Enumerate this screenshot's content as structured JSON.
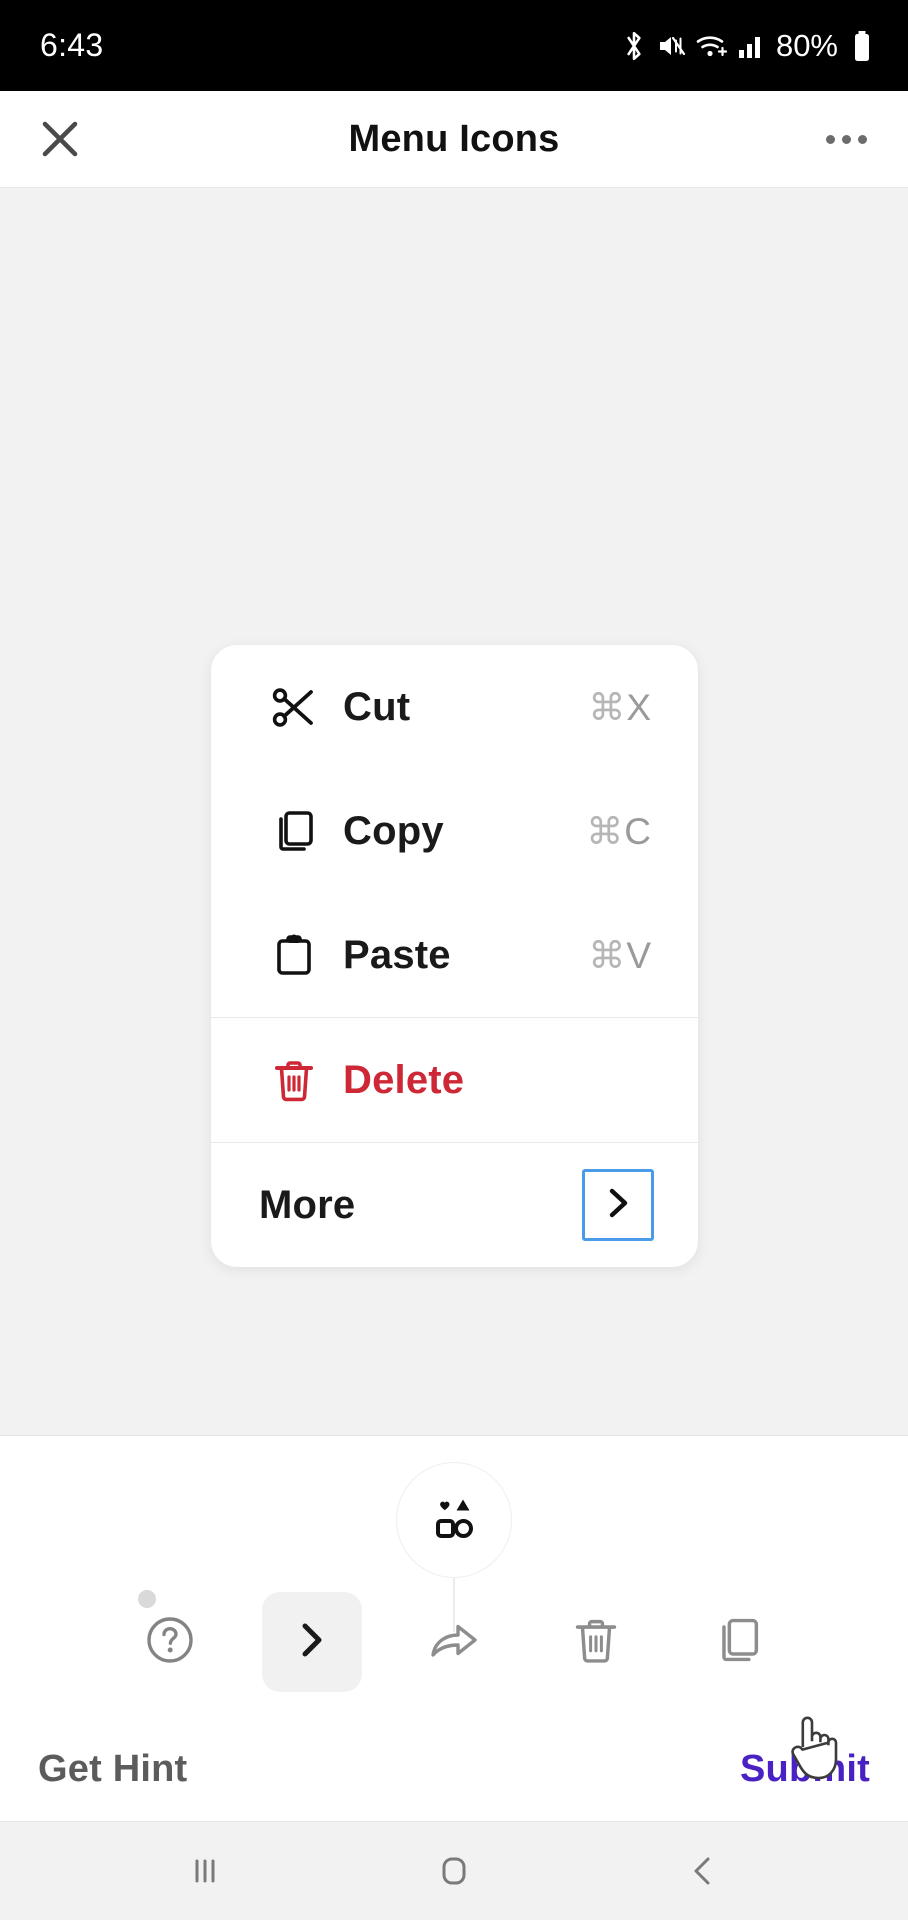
{
  "status_bar": {
    "time": "6:43",
    "battery_percent": "80%",
    "icons": [
      "bluetooth-icon",
      "mute-icon",
      "wifi-icon",
      "cellular-signal-icon",
      "battery-icon"
    ]
  },
  "app_bar": {
    "close_icon": "close-icon",
    "title": "Menu Icons",
    "overflow_icon": "overflow-menu-icon"
  },
  "menu": {
    "groups": [
      {
        "items": [
          {
            "icon": "scissors-icon",
            "label": "Cut",
            "shortcut_cmd": "⌘",
            "shortcut_key": "X",
            "danger": false
          },
          {
            "icon": "copy-icon",
            "label": "Copy",
            "shortcut_cmd": "⌘",
            "shortcut_key": "C",
            "danger": false
          },
          {
            "icon": "clipboard-icon",
            "label": "Paste",
            "shortcut_cmd": "⌘",
            "shortcut_key": "V",
            "danger": false
          }
        ]
      },
      {
        "items": [
          {
            "icon": "trash-icon",
            "label": "Delete",
            "shortcut_cmd": "",
            "shortcut_key": "",
            "danger": true
          }
        ]
      },
      {
        "items": [
          {
            "icon": "",
            "label": "More",
            "shortcut_cmd": "",
            "shortcut_key": "",
            "danger": false,
            "drop_target_icon": "chevron-right-icon"
          }
        ]
      }
    ]
  },
  "palette": {
    "button_icon": "shapes-icon"
  },
  "tray": {
    "items": [
      {
        "icon": "help-circle-icon",
        "selected": false,
        "badge": true
      },
      {
        "icon": "chevron-right-icon",
        "selected": true,
        "badge": false
      },
      {
        "icon": "share-arrow-icon",
        "selected": false,
        "badge": false
      },
      {
        "icon": "trash-icon",
        "selected": false,
        "badge": false
      },
      {
        "icon": "copy-icon",
        "selected": false,
        "badge": false
      }
    ]
  },
  "actions": {
    "hint_label": "Get Hint",
    "submit_label": "Submit"
  },
  "nav_bar": {
    "recents_icon": "recents-icon",
    "home_icon": "home-icon",
    "back_icon": "back-icon"
  },
  "colors": {
    "danger": "#ce2836",
    "accent": "#4a22c4",
    "drop_border": "#4a9be8",
    "stage_bg": "#f2f2f2"
  }
}
